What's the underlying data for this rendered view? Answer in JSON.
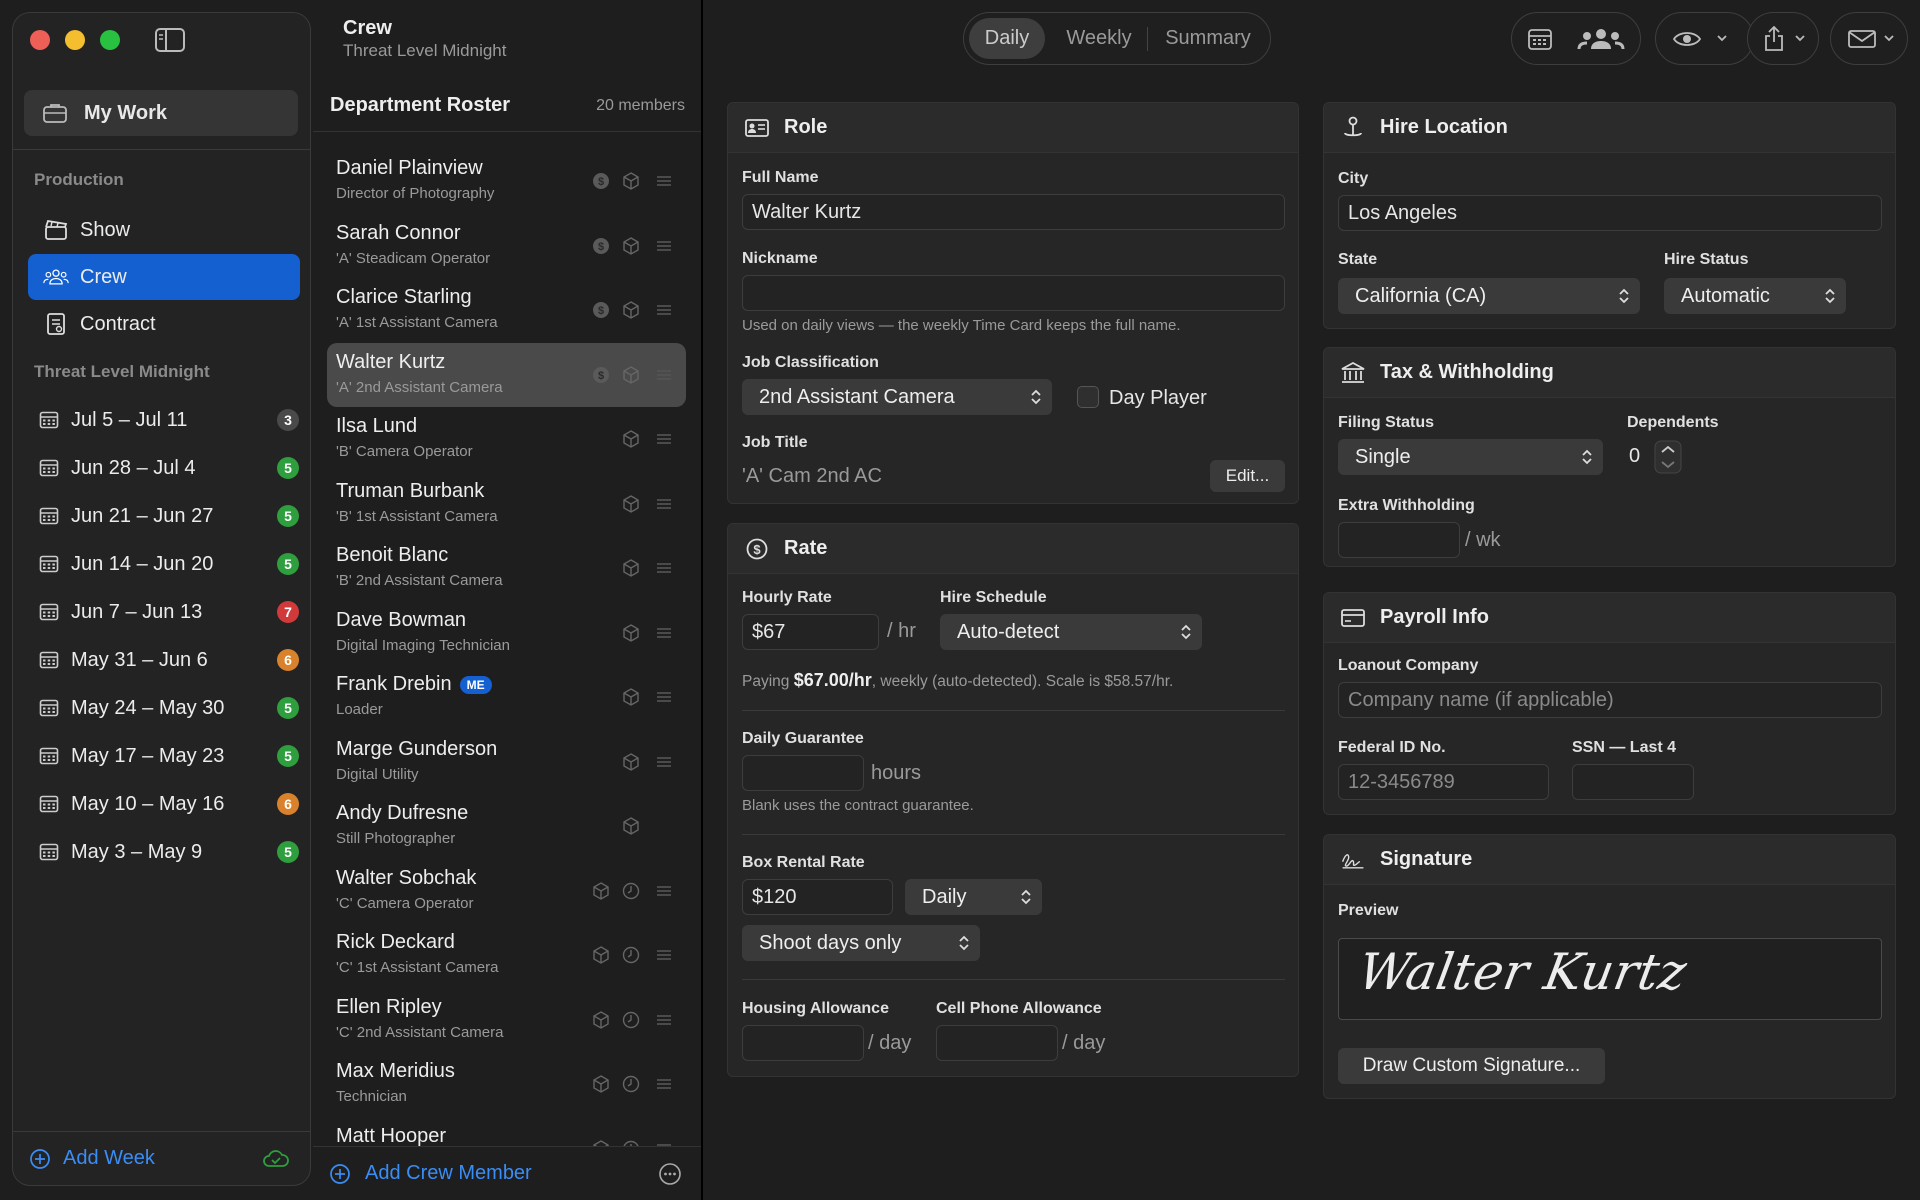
{
  "sidebar": {
    "my_work": "My Work",
    "section_production": "Production",
    "production_items": [
      {
        "label": "Show",
        "icon": "clapperboard-icon"
      },
      {
        "label": "Crew",
        "icon": "people-icon",
        "active": true
      },
      {
        "label": "Contract",
        "icon": "document-icon"
      }
    ],
    "section_show": "Threat Level Midnight",
    "weeks": [
      {
        "label": "Jul 5 – Jul 11",
        "count": "3",
        "color": "#4a4a4a"
      },
      {
        "label": "Jun 28 – Jul 4",
        "count": "5",
        "color": "#2e9e3e"
      },
      {
        "label": "Jun 21 – Jun 27",
        "count": "5",
        "color": "#2e9e3e"
      },
      {
        "label": "Jun 14 – Jun 20",
        "count": "5",
        "color": "#2e9e3e"
      },
      {
        "label": "Jun 7 – Jun 13",
        "count": "7",
        "color": "#d13a3a"
      },
      {
        "label": "May 31 – Jun 6",
        "count": "6",
        "color": "#d9822b"
      },
      {
        "label": "May 24 – May 30",
        "count": "5",
        "color": "#2e9e3e"
      },
      {
        "label": "May 17 – May 23",
        "count": "5",
        "color": "#2e9e3e"
      },
      {
        "label": "May 10 – May 16",
        "count": "6",
        "color": "#d9822b"
      },
      {
        "label": "May 3 – May 9",
        "count": "5",
        "color": "#2e9e3e"
      }
    ],
    "add_week": "Add Week"
  },
  "roster": {
    "title": "Crew",
    "subtitle": "Threat Level Midnight",
    "dept_title": "Department Roster",
    "dept_count": "20 members",
    "members": [
      {
        "name": "Daniel Plainview",
        "role": "Director of Photography",
        "icons": [
          "dollar-icon",
          "box-icon",
          "drag-handle-icon"
        ]
      },
      {
        "name": "Sarah Connor",
        "role": "'A' Steadicam Operator",
        "icons": [
          "dollar-icon",
          "box-icon",
          "drag-handle-icon"
        ]
      },
      {
        "name": "Clarice Starling",
        "role": "'A' 1st Assistant Camera",
        "icons": [
          "dollar-icon",
          "box-icon",
          "drag-handle-icon"
        ]
      },
      {
        "name": "Walter Kurtz",
        "role": "'A' 2nd Assistant Camera",
        "icons": [
          "dollar-icon",
          "box-icon",
          "drag-handle-icon"
        ],
        "selected": true
      },
      {
        "name": "Ilsa Lund",
        "role": "'B' Camera Operator",
        "icons": [
          "",
          "box-icon",
          "drag-handle-icon"
        ]
      },
      {
        "name": "Truman Burbank",
        "role": "'B' 1st Assistant Camera",
        "icons": [
          "",
          "box-icon",
          "drag-handle-icon"
        ]
      },
      {
        "name": "Benoit Blanc",
        "role": "'B' 2nd Assistant Camera",
        "icons": [
          "",
          "box-icon",
          "drag-handle-icon"
        ]
      },
      {
        "name": "Dave Bowman",
        "role": "Digital Imaging Technician",
        "icons": [
          "",
          "box-icon",
          "drag-handle-icon"
        ]
      },
      {
        "name": "Frank Drebin",
        "role": "Loader",
        "me": "ME",
        "icons": [
          "",
          "box-icon",
          "drag-handle-icon"
        ]
      },
      {
        "name": "Marge Gunderson",
        "role": "Digital Utility",
        "icons": [
          "",
          "box-icon",
          "drag-handle-icon"
        ]
      },
      {
        "name": "Andy Dufresne",
        "role": "Still Photographer",
        "icons": [
          "",
          "box-icon",
          ""
        ]
      },
      {
        "name": "Walter Sobchak",
        "role": "'C' Camera Operator",
        "icons": [
          "box-icon",
          "clock-icon",
          "drag-handle-icon"
        ]
      },
      {
        "name": "Rick Deckard",
        "role": "'C' 1st Assistant Camera",
        "icons": [
          "box-icon",
          "clock-icon",
          "drag-handle-icon"
        ]
      },
      {
        "name": "Ellen Ripley",
        "role": "'C' 2nd Assistant Camera",
        "icons": [
          "box-icon",
          "clock-icon",
          "drag-handle-icon"
        ]
      },
      {
        "name": "Max Meridius",
        "role": "Technician",
        "icons": [
          "box-icon",
          "clock-icon",
          "drag-handle-icon"
        ]
      },
      {
        "name": "Matt Hooper",
        "role": "",
        "icons": [
          "box-icon",
          "clock-icon",
          "drag-handle-icon"
        ]
      }
    ],
    "add_member": "Add Crew Member"
  },
  "toolbar": {
    "tabs": [
      "Daily",
      "Weekly",
      "Summary"
    ],
    "active_tab": "Daily"
  },
  "role": {
    "title": "Role",
    "full_name_label": "Full Name",
    "full_name": "Walter Kurtz",
    "nickname_label": "Nickname",
    "nickname": "",
    "nickname_help": "Used on daily views — the weekly Time Card keeps the full name.",
    "job_class_label": "Job Classification",
    "job_class": "2nd Assistant Camera",
    "day_player": "Day Player",
    "job_title_label": "Job Title",
    "job_title": "'A' Cam 2nd AC",
    "edit": "Edit..."
  },
  "rate": {
    "title": "Rate",
    "hourly_label": "Hourly Rate",
    "hourly": "$67",
    "per_hr": "/ hr",
    "schedule_label": "Hire Schedule",
    "schedule": "Auto-detect",
    "paying_prefix": "Paying ",
    "paying_amount": "$67.00/hr",
    "paying_suffix": ", weekly (auto-detected).  Scale is $58.57/hr.",
    "guarantee_label": "Daily Guarantee",
    "hours": "hours",
    "guarantee_help": "Blank uses the contract guarantee.",
    "box_label": "Box Rental Rate",
    "box": "$120",
    "box_period": "Daily",
    "box_days": "Shoot days only",
    "housing_label": "Housing Allowance",
    "cell_label": "Cell Phone Allowance",
    "per_day": "/ day"
  },
  "hire": {
    "title": "Hire Location",
    "city_label": "City",
    "city": "Los Angeles",
    "state_label": "State",
    "state": "California (CA)",
    "status_label": "Hire Status",
    "status": "Automatic"
  },
  "tax": {
    "title": "Tax & Withholding",
    "filing_label": "Filing Status",
    "filing": "Single",
    "dependents_label": "Dependents",
    "dependents": "0",
    "extra_label": "Extra Withholding",
    "per_wk": "/ wk"
  },
  "payroll": {
    "title": "Payroll Info",
    "loanout_label": "Loanout Company",
    "loanout_placeholder": "Company name (if applicable)",
    "fein_label": "Federal ID No.",
    "fein_placeholder": "12-3456789",
    "ssn_label": "SSN — Last 4"
  },
  "signature": {
    "title": "Signature",
    "preview_label": "Preview",
    "signature_text": "Walter Kurtz",
    "draw_button": "Draw Custom Signature..."
  },
  "colors": {
    "accent": "#1560d1",
    "link": "#3a8df5",
    "badge_green": "#2e9e3e",
    "badge_red": "#d13a3a",
    "badge_orange": "#d9822b"
  }
}
